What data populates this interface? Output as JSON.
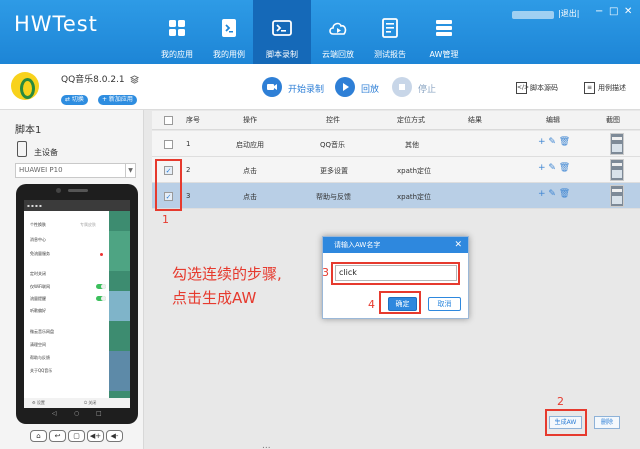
{
  "app": {
    "logo": "HWTest",
    "logout": "|退出|",
    "win_min": "−",
    "win_max": "□",
    "win_close": "✕"
  },
  "nav": [
    {
      "label": "我的应用",
      "icon": "grid-icon"
    },
    {
      "label": "我的用例",
      "icon": "terminal-file-icon"
    },
    {
      "label": "脚本录制",
      "icon": "record-terminal-icon"
    },
    {
      "label": "云端回放",
      "icon": "cloud-play-icon"
    },
    {
      "label": "测试报告",
      "icon": "report-icon"
    },
    {
      "label": "AW管理",
      "icon": "layers-icon"
    }
  ],
  "active_nav": "脚本录制",
  "subbar": {
    "app_name": "QQ音乐8.0.2.1",
    "switch_label": "⇄ 切换",
    "new_app_label": "+ 新加应用",
    "start_record": "开始录制",
    "replay": "回放",
    "stop": "停止",
    "script_source": "脚本源码",
    "case_desc": "用例描述"
  },
  "left": {
    "script_title": "脚本1",
    "device_label": "主设备",
    "device_select": "HUAWEI P10",
    "phone_menu": [
      "个性换肤",
      "消息中心",
      "免流量服务",
      "定时关闭",
      "仅WiFi联网",
      "流量提醒",
      "听歌偏好",
      "微云音乐网盘",
      "清理空间",
      "帮助与反馈",
      "关于QQ音乐"
    ],
    "phone_statusbar": "▪ ▪ ▪ ▪",
    "phone_settings": "⚙ 设置",
    "phone_close": "⏻ 关闭",
    "phone_skin_right": "专属皮肤",
    "phone_buttons": [
      "⌂",
      "↩",
      "▢",
      "◀+",
      "◀-"
    ]
  },
  "table": {
    "headers": [
      "序号",
      "操作",
      "控件",
      "定位方式",
      "结果",
      "编辑",
      "截图"
    ],
    "rows": [
      {
        "num": "1",
        "op": "启动应用",
        "ctrl": "QQ音乐",
        "locate": "其他",
        "result": "",
        "checked": false
      },
      {
        "num": "2",
        "op": "点击",
        "ctrl": "更多设置",
        "locate": "xpath定位",
        "result": "",
        "checked": true
      },
      {
        "num": "3",
        "op": "点击",
        "ctrl": "帮助与反馈",
        "locate": "xpath定位",
        "result": "",
        "checked": true
      }
    ],
    "edit_icons": "+ ✎ 🗑"
  },
  "annotations": {
    "n1": "1",
    "n2": "2",
    "n3": "3",
    "n4": "4",
    "instruction_line1": "勾选连续的步骤,",
    "instruction_line2": "点击生成AW"
  },
  "dialog": {
    "title": "请输入AW名字",
    "close": "✕",
    "input_value": "click",
    "ok": "确定",
    "cancel": "取消"
  },
  "buttons": {
    "generate_aw": "生成AW",
    "delete": "删除"
  },
  "bottom_text": "..."
}
